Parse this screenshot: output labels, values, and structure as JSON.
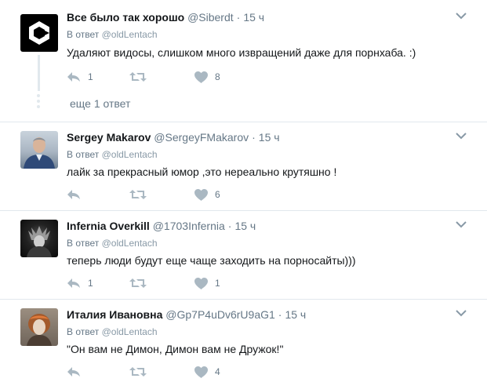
{
  "tweets": [
    {
      "name": "Все было так хорошо",
      "handle": "@Siberdt",
      "time": "15 ч",
      "reply_prefix": "В ответ",
      "reply_to": "@oldLentach",
      "text": "Удаляют видосы, слишком много извращений даже для порнхаба. :)",
      "replies": "1",
      "retweets": "",
      "likes": "8"
    },
    {
      "name": "Sergey Makarov",
      "handle": "@SergeyFMakarov",
      "time": "15 ч",
      "reply_prefix": "В ответ",
      "reply_to": "@oldLentach",
      "text": "лайк за прекрасный юмор ,это нереально крутяшно !",
      "replies": "",
      "retweets": "",
      "likes": "6"
    },
    {
      "name": "Infernia Overkill",
      "handle": "@1703Infernia",
      "time": "15 ч",
      "reply_prefix": "В ответ",
      "reply_to": "@oldLentach",
      "text": "теперь люди будут еще чаще заходить на порносайты)))",
      "replies": "1",
      "retweets": "",
      "likes": "1"
    },
    {
      "name": "Италия Ивановна",
      "handle": "@Gp7P4uDv6rU9aG1",
      "time": "15 ч",
      "reply_prefix": "В ответ",
      "reply_to": "@oldLentach",
      "text": "\"Он вам не Димон, Димон вам не Дружок!\"",
      "replies": "",
      "retweets": "",
      "likes": "4"
    }
  ],
  "thread": {
    "more_replies": "еще 1 ответ"
  },
  "separator": "·",
  "icons": {
    "reply": "reply-icon",
    "retweet": "retweet-icon",
    "like": "heart-icon",
    "menu": "chevron-down-icon"
  },
  "colors": {
    "icon_gray": "#aab8c2",
    "text_secondary": "#657786",
    "divider": "#e1e8ed"
  }
}
